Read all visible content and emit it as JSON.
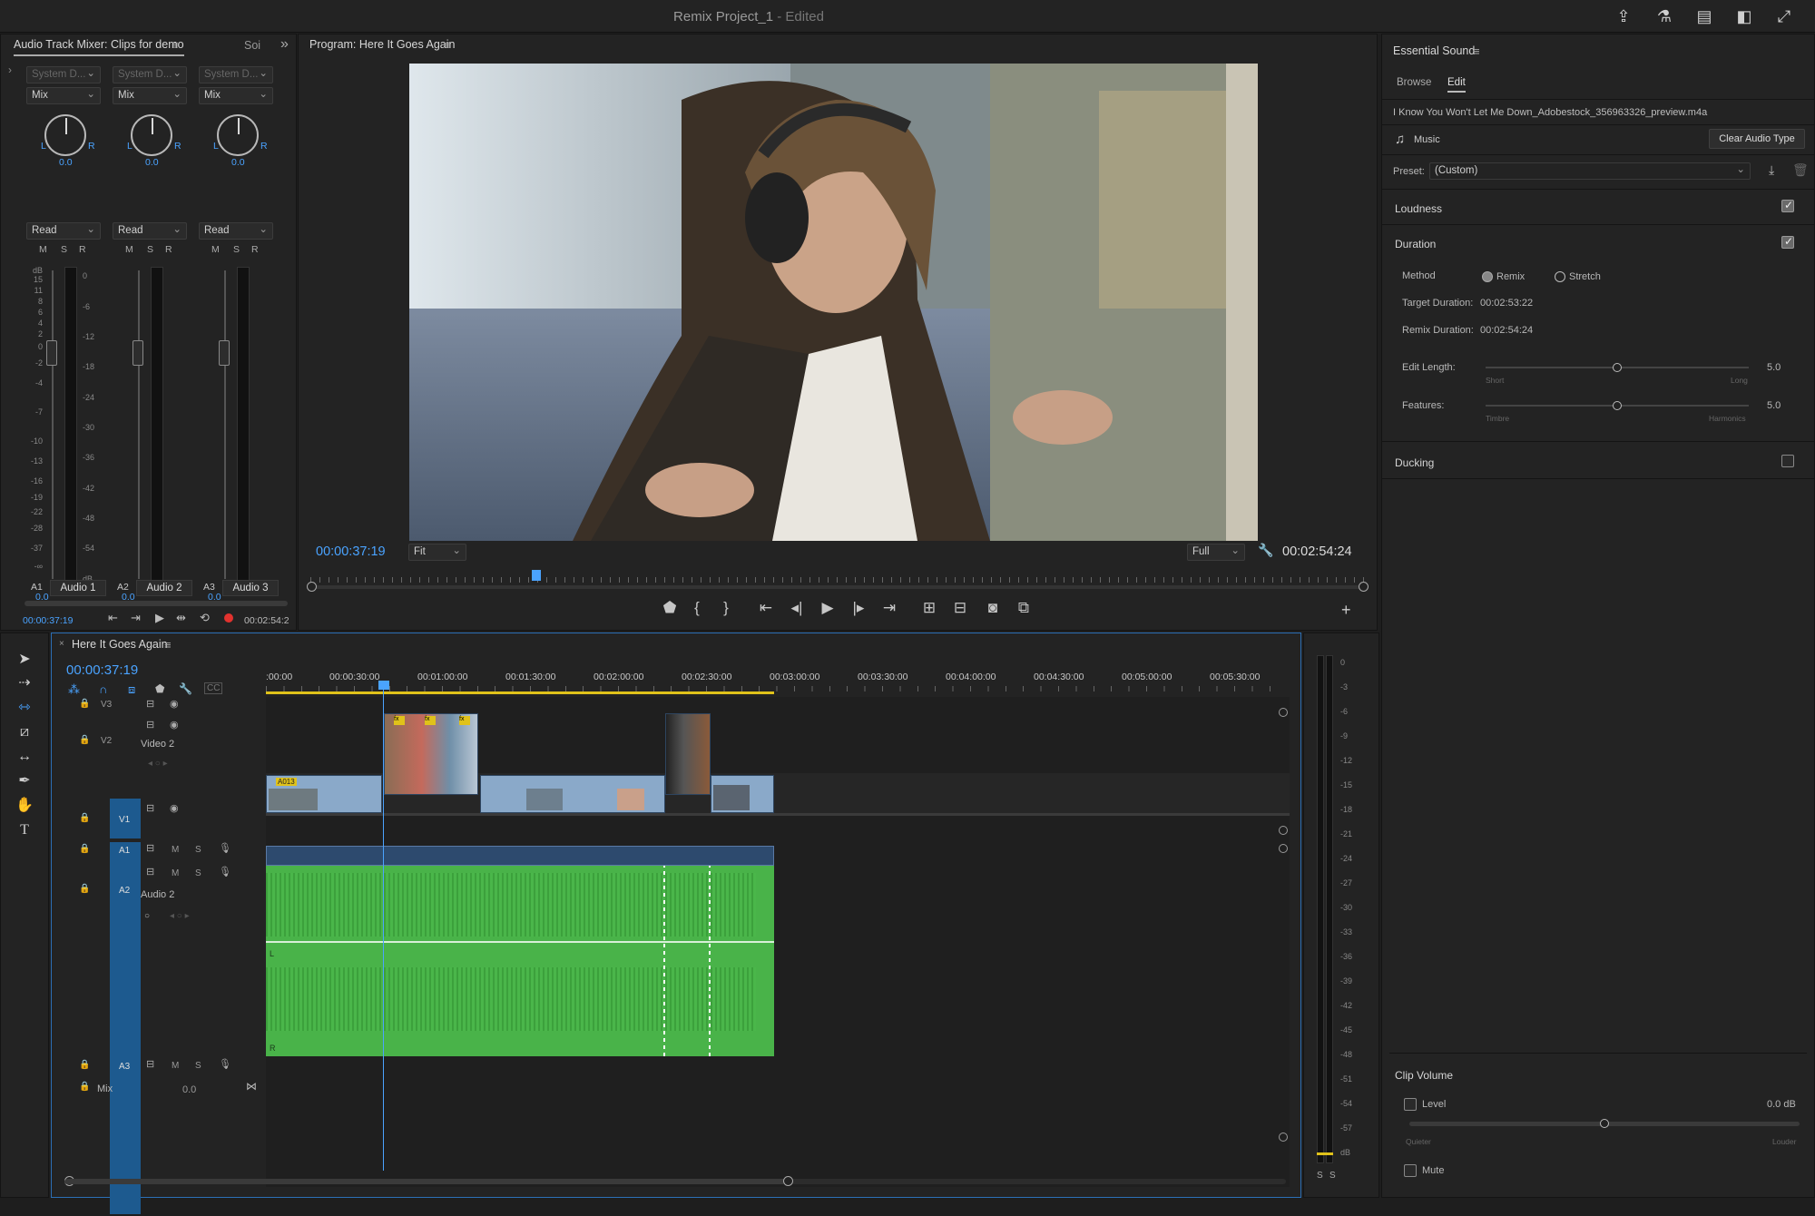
{
  "app": {
    "title": "Remix Project_1",
    "edited": " - Edited"
  },
  "mixer": {
    "tab_label": "Audio Track Mixer: Clips for demo",
    "tab2_label": "Soi",
    "channels": [
      {
        "input": "System D...",
        "mode": "Mix",
        "pan_l": "L",
        "pan_r": "R",
        "pan_value": "0.0",
        "automation": "Read",
        "m": "M",
        "s": "S",
        "r": "R",
        "volume": "0.0",
        "track_id": "A1",
        "track_name": "Audio 1"
      },
      {
        "input": "System D...",
        "mode": "Mix",
        "pan_l": "L",
        "pan_r": "R",
        "pan_value": "0.0",
        "automation": "Read",
        "m": "M",
        "s": "S",
        "r": "R",
        "volume": "0.0",
        "track_id": "A2",
        "track_name": "Audio 2"
      },
      {
        "input": "System D...",
        "mode": "Mix",
        "pan_l": "L",
        "pan_r": "R",
        "pan_value": "0.0",
        "automation": "Read",
        "m": "M",
        "s": "S",
        "r": "R",
        "volume": "0.0",
        "track_id": "A3",
        "track_name": "Audio 3"
      }
    ],
    "fader_scale": [
      "dB",
      "15",
      "11",
      "8",
      "6",
      "4",
      "2",
      "0",
      "-2",
      "-4",
      "-7",
      "-10",
      "-13",
      "-16",
      "-19",
      "-22",
      "-28",
      "-37",
      "-∞"
    ],
    "meter_scale": [
      "0",
      "-6",
      "-12",
      "-18",
      "-24",
      "-30",
      "-36",
      "-42",
      "-48",
      "-54",
      "dB"
    ],
    "timecode_in": "00:00:37:19",
    "timecode_out": "00:02:54:2"
  },
  "program": {
    "tab_label": "Program: Here It Goes Again",
    "timecode": "00:00:37:19",
    "zoom": "Fit",
    "resolution": "Full",
    "duration": "00:02:54:24",
    "playhead_fraction": 0.214
  },
  "essential": {
    "tab_label": "Essential Sound",
    "tabs": [
      "Browse",
      "Edit"
    ],
    "filename": "I Know You Won't Let Me Down_Adobestock_356963326_preview.m4a",
    "audio_type": "Music",
    "clear_button": "Clear Audio Type",
    "preset_label": "Preset:",
    "preset_value": "(Custom)",
    "loudness": "Loudness",
    "duration": "Duration",
    "method_label": "Method",
    "method_remix": "Remix",
    "method_stretch": "Stretch",
    "target_label": "Target Duration:",
    "target_value": "00:02:53:22",
    "remix_label": "Remix Duration:",
    "remix_value": "00:02:54:24",
    "edit_length_label": "Edit Length:",
    "edit_length_min": "Short",
    "edit_length_max": "Long",
    "edit_length_value": "5.0",
    "features_label": "Features:",
    "features_min": "Timbre",
    "features_max": "Harmonics",
    "features_value": "5.0",
    "ducking": "Ducking",
    "clip_volume": "Clip Volume",
    "level_label": "Level",
    "level_value": "0.0 dB",
    "quieter": "Quieter",
    "louder": "Louder",
    "mute_label": "Mute"
  },
  "timeline": {
    "tab_label": "Here It Goes Again",
    "timecode": "00:00:37:19",
    "ruler": [
      ":00:00",
      "00:00:30:00",
      "00:01:00:00",
      "00:01:30:00",
      "00:02:00:00",
      "00:02:30:00",
      "00:03:00:00",
      "00:03:30:00",
      "00:04:00:00",
      "00:04:30:00",
      "00:05:00:00",
      "00:05:30:00"
    ],
    "tracks": {
      "v3": "V3",
      "v2": "V2",
      "v2_name": "Video 2",
      "v1": "V1",
      "a1": "A1",
      "a2": "A2",
      "a2_name": "Audio 2",
      "a3": "A3",
      "mix": "Mix",
      "mix_value": "0.0"
    },
    "clip_label": "A013",
    "m": "M",
    "s": "S"
  },
  "master_meter": {
    "scale": [
      "0",
      "-3",
      "-6",
      "-9",
      "-12",
      "-15",
      "-18",
      "-21",
      "-24",
      "-27",
      "-30",
      "-33",
      "-36",
      "-39",
      "-42",
      "-45",
      "-48",
      "-51",
      "-54",
      "-57",
      "dB"
    ],
    "s1": "S",
    "s2": "S"
  },
  "colors": {
    "accent": "#4aa3ff",
    "audio_clip": "#49b349",
    "video_clip": "#8aa9c9",
    "track_target": "#1d5a8f"
  }
}
